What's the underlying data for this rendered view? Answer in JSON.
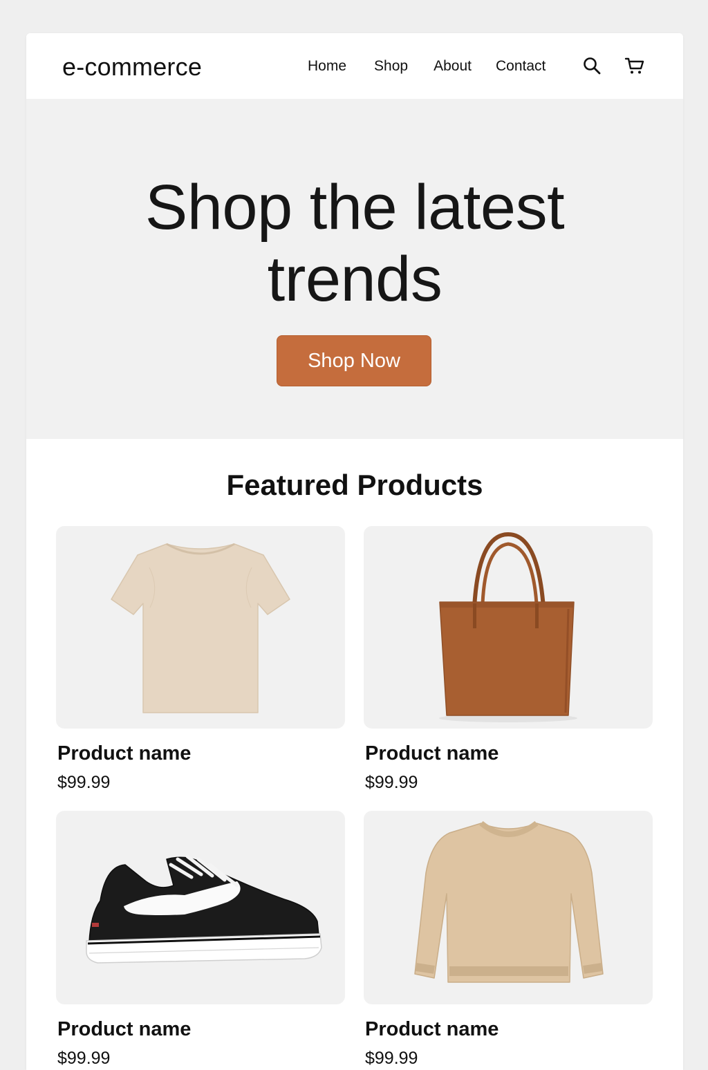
{
  "header": {
    "logo": "e-commerce",
    "nav": [
      "Home",
      "Shop",
      "About",
      "Contact"
    ],
    "icons": [
      "search-icon",
      "cart-icon"
    ]
  },
  "hero": {
    "title_line1": "Shop the latest",
    "title_line2": "trends",
    "cta_label": "Shop Now",
    "cta_color": "#c56d3d",
    "background": "#f1f1f1"
  },
  "featured": {
    "title": "Featured Products",
    "products": [
      {
        "name": "Product name",
        "price": "$99.99",
        "image": "beige t-shirt"
      },
      {
        "name": "Product name",
        "price": "$99.99",
        "image": "brown leather tote bag"
      },
      {
        "name": "Product name",
        "price": "$99.99",
        "image": "black and white sneaker"
      },
      {
        "name": "Product name",
        "price": "$99.99",
        "image": "beige knit sweater"
      }
    ]
  }
}
